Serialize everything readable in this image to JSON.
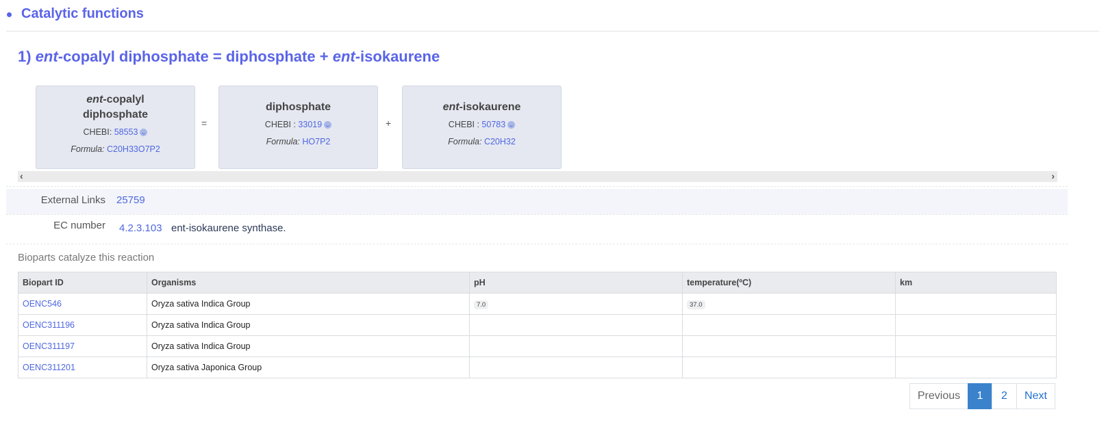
{
  "section": {
    "title": "Catalytic functions"
  },
  "reaction": {
    "number": "1)",
    "substrate": {
      "prefix": "ent",
      "rest": "-copalyl diphosphate"
    },
    "equals": "=",
    "product1": "diphosphate",
    "plus": "+",
    "product2": {
      "prefix": "ent",
      "rest": "-isokaurene"
    }
  },
  "compounds": [
    {
      "name_prefix": "ent",
      "name_line1": "-copalyl",
      "name_line2": "diphosphate",
      "chebi_label": "CHEBI: ",
      "chebi_id": "58553",
      "formula_label": "Formula: ",
      "formula": "C20H33O7P2"
    },
    {
      "name": "diphosphate",
      "chebi_label": "CHEBI : ",
      "chebi_id": "33019",
      "formula_label": "Formula: ",
      "formula": "HO7P2"
    },
    {
      "name_prefix": "ent",
      "name_rest": "-isokaurene",
      "chebi_label": "CHEBI : ",
      "chebi_id": "50783",
      "formula_label": "Formula: ",
      "formula": "C20H32"
    }
  ],
  "operators": {
    "equals": "=",
    "plus": "+"
  },
  "scrollbar": {
    "left": "‹",
    "right": "›"
  },
  "external_links": {
    "label": "External Links",
    "value": "25759"
  },
  "ec_number": {
    "label": "EC number",
    "value": "4.2.3.103",
    "description": "ent-isokaurene synthase."
  },
  "bioparts": {
    "title": "Bioparts catalyze this reaction",
    "columns": [
      "Biopart ID",
      "Organisms",
      "pH",
      "temperature(ºC)",
      "km"
    ],
    "rows": [
      {
        "id": "OENC546",
        "organism": "Oryza sativa Indica Group",
        "ph": "7.0",
        "temperature": "37.0",
        "km": ""
      },
      {
        "id": "OENC311196",
        "organism": "Oryza sativa Indica Group",
        "ph": "",
        "temperature": "",
        "km": ""
      },
      {
        "id": "OENC311197",
        "organism": "Oryza sativa Indica Group",
        "ph": "",
        "temperature": "",
        "km": ""
      },
      {
        "id": "OENC311201",
        "organism": "Oryza sativa Japonica Group",
        "ph": "",
        "temperature": "",
        "km": ""
      }
    ]
  },
  "pagination": {
    "previous": "Previous",
    "pages": [
      "1",
      "2"
    ],
    "active": "1",
    "next": "Next"
  }
}
